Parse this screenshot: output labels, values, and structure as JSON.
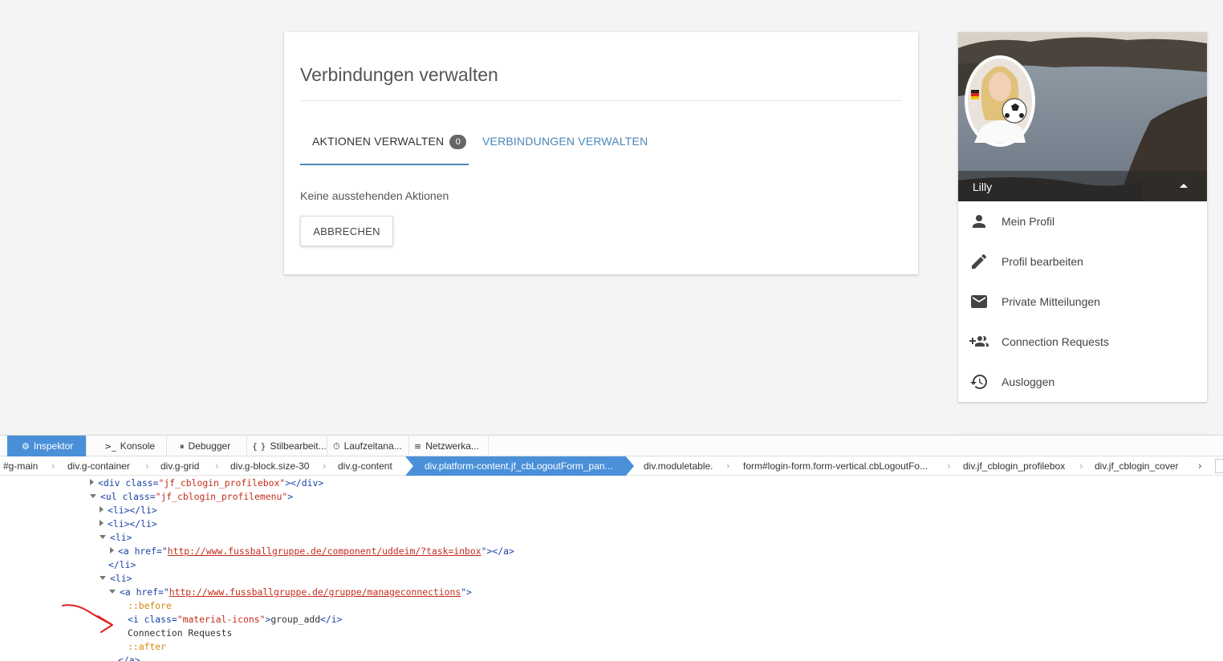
{
  "card": {
    "title": "Verbindungen verwalten",
    "tabs": [
      {
        "label": "AKTIONEN VERWALTEN",
        "badge": "0",
        "active": true
      },
      {
        "label": "VERBINDUNGEN VERWALTEN",
        "active": false
      }
    ],
    "empty_text": "Keine ausstehenden Aktionen",
    "cancel_label": "ABBRECHEN"
  },
  "profile": {
    "name": "Lilly",
    "menu": [
      {
        "label": "Mein Profil",
        "icon": "person-icon"
      },
      {
        "label": "Profil bearbeiten",
        "icon": "edit-icon"
      },
      {
        "label": "Private Mitteilungen",
        "icon": "mail-icon"
      },
      {
        "label": "Connection Requests",
        "icon": "group-add-icon"
      },
      {
        "label": "Ausloggen",
        "icon": "history-icon"
      }
    ]
  },
  "devtools": {
    "tabs": [
      {
        "label": "Inspektor",
        "icon": "gear"
      },
      {
        "label": "Konsole",
        "icon": "console"
      },
      {
        "label": "Debugger",
        "icon": "pause"
      },
      {
        "label": "Stilbearbeit...",
        "icon": "braces"
      },
      {
        "label": "Laufzeitana...",
        "icon": "stopwatch"
      },
      {
        "label": "Netzwerka...",
        "icon": "lines"
      }
    ],
    "breadcrumbs": [
      "#g-main",
      "div.g-container",
      "div.g-grid",
      "div.g-block.size-30",
      "div.g-content",
      "div.platform-content.jf_cbLogoutForm_pan...",
      "div.moduletable.",
      "form#login-form.form-vertical.cbLogoutFo...",
      "div.jf_cblogin_profilebox",
      "div.jf_cblogin_cover"
    ],
    "code": {
      "div_tag": "div",
      "class_attr": "class",
      "profilebox_class": "\"jf_cblogin_profilebox\"",
      "ul_tag": "ul",
      "profilemenu_class": "\"jf_cblogin_profilemenu\"",
      "li_tag": "li",
      "a_tag": "a",
      "href_attr": "href",
      "inbox_url": "http://www.fussballgruppe.de/component/uddeim/?task=inbox",
      "connections_url": "http://www.fussballgruppe.de/gruppe/manageconnections",
      "before": "::before",
      "i_tag": "i",
      "icon_class": "\"material-icons\"",
      "icon_text": "group_add",
      "link_text": "Connection Requests",
      "after": "::after"
    }
  }
}
